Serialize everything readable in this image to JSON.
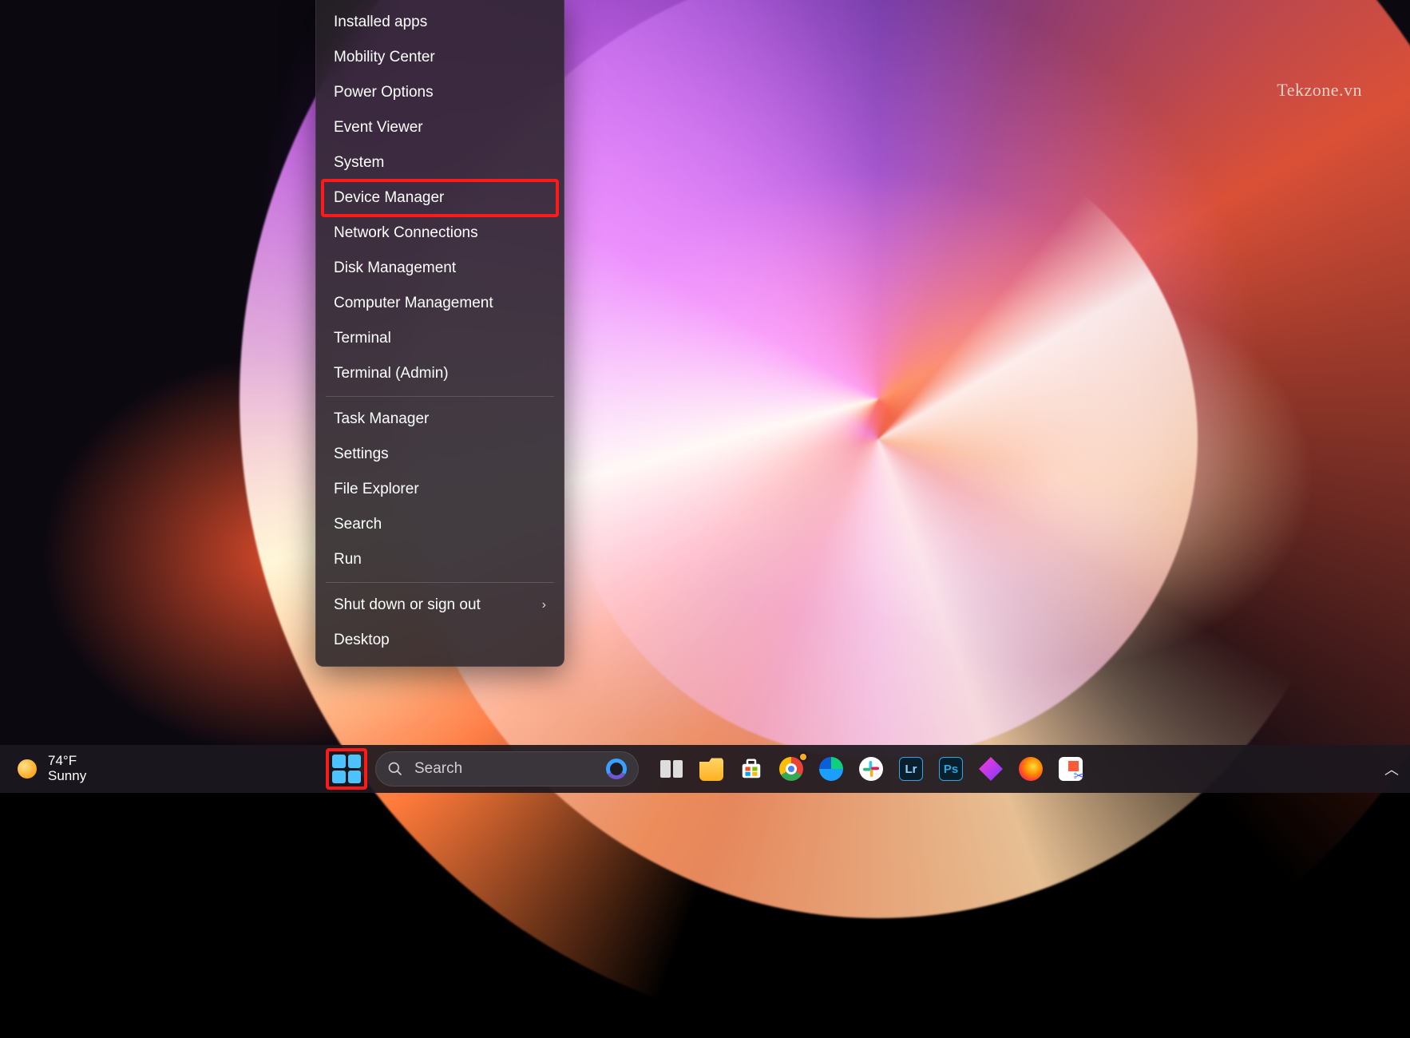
{
  "watermark": "Tekzone.vn",
  "winx_menu": {
    "groups": [
      [
        {
          "label": "Installed apps",
          "highlighted": false,
          "submenu": false
        },
        {
          "label": "Mobility Center",
          "highlighted": false,
          "submenu": false
        },
        {
          "label": "Power Options",
          "highlighted": false,
          "submenu": false
        },
        {
          "label": "Event Viewer",
          "highlighted": false,
          "submenu": false
        },
        {
          "label": "System",
          "highlighted": false,
          "submenu": false
        },
        {
          "label": "Device Manager",
          "highlighted": true,
          "submenu": false
        },
        {
          "label": "Network Connections",
          "highlighted": false,
          "submenu": false
        },
        {
          "label": "Disk Management",
          "highlighted": false,
          "submenu": false
        },
        {
          "label": "Computer Management",
          "highlighted": false,
          "submenu": false
        },
        {
          "label": "Terminal",
          "highlighted": false,
          "submenu": false
        },
        {
          "label": "Terminal (Admin)",
          "highlighted": false,
          "submenu": false
        }
      ],
      [
        {
          "label": "Task Manager",
          "highlighted": false,
          "submenu": false
        },
        {
          "label": "Settings",
          "highlighted": false,
          "submenu": false
        },
        {
          "label": "File Explorer",
          "highlighted": false,
          "submenu": false
        },
        {
          "label": "Search",
          "highlighted": false,
          "submenu": false
        },
        {
          "label": "Run",
          "highlighted": false,
          "submenu": false
        }
      ],
      [
        {
          "label": "Shut down or sign out",
          "highlighted": false,
          "submenu": true
        },
        {
          "label": "Desktop",
          "highlighted": false,
          "submenu": false
        }
      ]
    ]
  },
  "taskbar": {
    "weather": {
      "temp": "74°F",
      "condition": "Sunny"
    },
    "start_highlighted": true,
    "search": {
      "placeholder": "Search"
    },
    "pinned": [
      {
        "name": "task-view",
        "kind": "taskview"
      },
      {
        "name": "file-explorer",
        "kind": "folder"
      },
      {
        "name": "microsoft-store",
        "kind": "store"
      },
      {
        "name": "google-chrome",
        "kind": "chrome",
        "badge": true
      },
      {
        "name": "microsoft-edge",
        "kind": "edge"
      },
      {
        "name": "slack",
        "kind": "slack"
      },
      {
        "name": "lightroom",
        "kind": "lr",
        "text": "Lr"
      },
      {
        "name": "photoshop",
        "kind": "ps",
        "text": "Ps"
      },
      {
        "name": "affinity-photo",
        "kind": "affinity"
      },
      {
        "name": "firefox",
        "kind": "firefox"
      },
      {
        "name": "snipping-tool",
        "kind": "snip"
      }
    ]
  }
}
